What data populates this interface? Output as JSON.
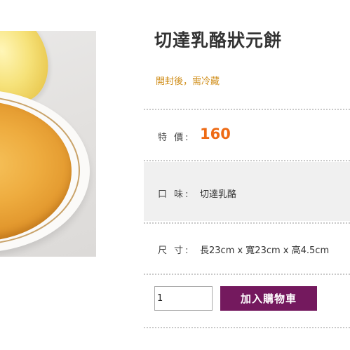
{
  "product": {
    "name": "切達乳酪狀元餅",
    "storage_note": "開封後，需冷藏"
  },
  "price_row": {
    "label": "特 價:",
    "value": "160"
  },
  "flavor_row": {
    "label": "口 味:",
    "value": "切達乳酪"
  },
  "size_row": {
    "label": "尺 寸:",
    "value": "長23cm x 寬23cm x 高4.5cm"
  },
  "purchase": {
    "quantity": "1",
    "add_to_cart_label": "加入購物車"
  },
  "colors": {
    "price": "#ee6a14",
    "note": "#d08d18",
    "button": "#74195e"
  }
}
